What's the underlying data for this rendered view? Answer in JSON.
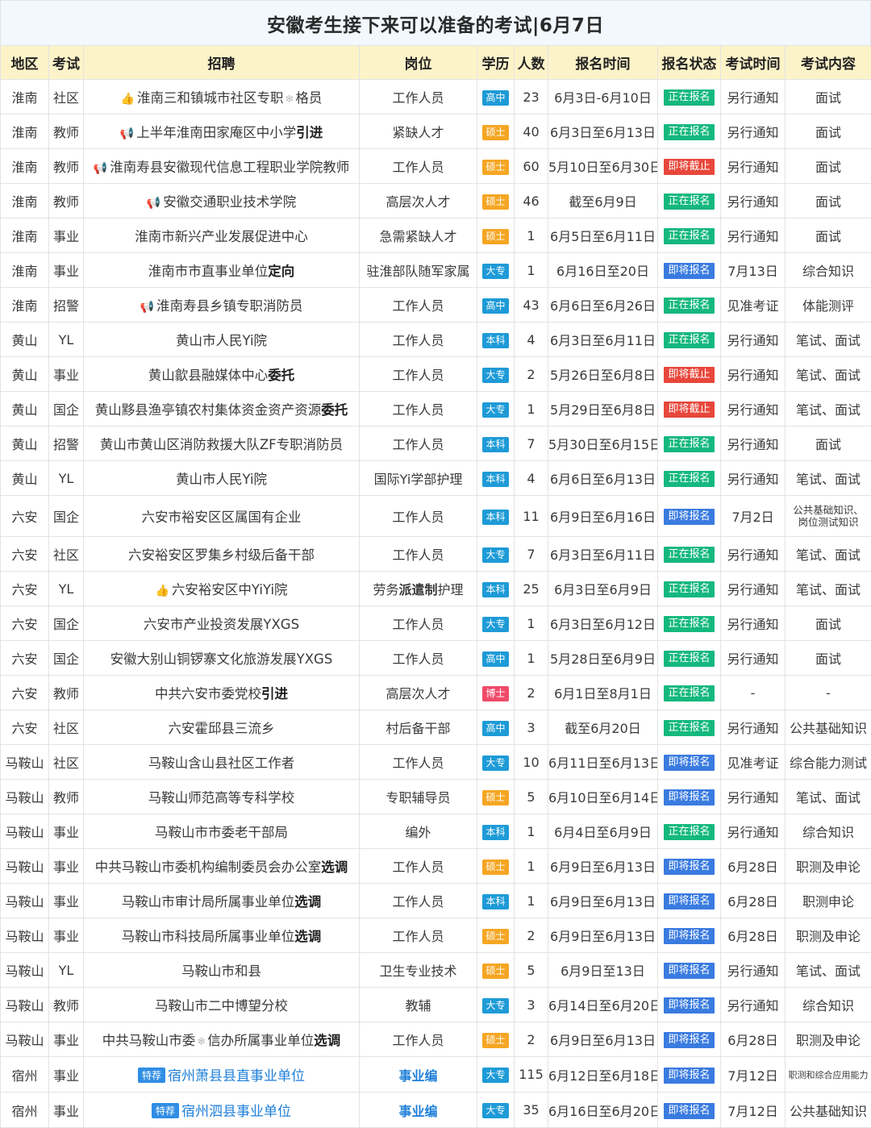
{
  "title": "安徽考生接下来可以准备的考试|6月7日",
  "headers": [
    "地区",
    "考试",
    "招聘",
    "岗位",
    "学历",
    "人数",
    "报名时间",
    "报名状态",
    "考试时间",
    "考试内容"
  ],
  "rows": [
    {
      "region": "淮南",
      "type": "社区",
      "icon": "thumb",
      "recruit": [
        "淮南三和镇城市社区专职",
        "*",
        "格员"
      ],
      "post": "工作人员",
      "edu": "高中",
      "num": "23",
      "reg": "6月3日-6月10日",
      "status": "正在报名",
      "exam": "另行通知",
      "content": "面试"
    },
    {
      "region": "淮南",
      "type": "教师",
      "icon": "megaphone",
      "recruit": [
        "上半年淮南田家庵区中小学"
      ],
      "recruit_bold": "引进",
      "post": "紧缺人才",
      "edu": "硕士",
      "num": "40",
      "reg": "6月3日至6月13日",
      "status": "正在报名",
      "exam": "另行通知",
      "content": "面试"
    },
    {
      "region": "淮南",
      "type": "教师",
      "icon": "megaphone",
      "recruit": [
        "淮南寿县安徽现代信息工程职业学院教师"
      ],
      "post": "工作人员",
      "edu": "硕士",
      "num": "60",
      "reg": "5月10日至6月30日",
      "status": "即将截止",
      "exam": "另行通知",
      "content": "面试"
    },
    {
      "region": "淮南",
      "type": "教师",
      "icon": "megaphone",
      "recruit": [
        "安徽交通职业技术学院"
      ],
      "post": "高层次人才",
      "edu": "硕士",
      "num": "46",
      "reg": "截至6月9日",
      "status": "正在报名",
      "exam": "另行通知",
      "content": "面试"
    },
    {
      "region": "淮南",
      "type": "事业",
      "recruit": [
        "淮南市新兴产业发展促进中心"
      ],
      "post": "急需紧缺人才",
      "edu": "硕士",
      "num": "1",
      "reg": "6月5日至6月11日",
      "status": "正在报名",
      "exam": "另行通知",
      "content": "面试"
    },
    {
      "region": "淮南",
      "type": "事业",
      "recruit": [
        "淮南市市直事业单位"
      ],
      "recruit_bold": "定向",
      "post": "驻淮部队随军家属",
      "edu": "大专",
      "num": "1",
      "reg": "6月16日至20日",
      "status": "即将报名",
      "exam": "7月13日",
      "content": "综合知识"
    },
    {
      "region": "淮南",
      "type": "招警",
      "icon": "megaphone",
      "recruit": [
        "淮南寿县乡镇专职消防员"
      ],
      "post": "工作人员",
      "edu": "高中",
      "num": "43",
      "reg": "6月6日至6月26日",
      "status": "正在报名",
      "exam": "见准考证",
      "content": "体能测评"
    },
    {
      "region": "黄山",
      "type": "YL",
      "recruit": [
        "黄山市人民Yi院"
      ],
      "post": "工作人员",
      "edu": "本科",
      "num": "4",
      "reg": "6月3日至6月11日",
      "status": "正在报名",
      "exam": "另行通知",
      "content": "笔试、面试"
    },
    {
      "region": "黄山",
      "type": "事业",
      "recruit": [
        "黄山歙县融媒体中心"
      ],
      "recruit_bold": "委托",
      "post": "工作人员",
      "edu": "大专",
      "num": "2",
      "reg": "5月26日至6月8日",
      "status": "即将截止",
      "exam": "另行通知",
      "content": "笔试、面试"
    },
    {
      "region": "黄山",
      "type": "国企",
      "recruit": [
        "黄山黟县渔亭镇农村集体资金资产资源"
      ],
      "recruit_bold": "委托",
      "post": "工作人员",
      "edu": "大专",
      "num": "1",
      "reg": "5月29日至6月8日",
      "status": "即将截止",
      "exam": "另行通知",
      "content": "笔试、面试"
    },
    {
      "region": "黄山",
      "type": "招警",
      "recruit": [
        "黄山市黄山区消防救援大队ZF专职消防员"
      ],
      "post": "工作人员",
      "edu": "本科",
      "num": "7",
      "reg": "5月30日至6月15日",
      "status": "正在报名",
      "exam": "另行通知",
      "content": "面试"
    },
    {
      "region": "黄山",
      "type": "YL",
      "recruit": [
        "黄山市人民Yi院"
      ],
      "post": "国际Yi学部护理",
      "edu": "本科",
      "num": "4",
      "reg": "6月6日至6月13日",
      "status": "正在报名",
      "exam": "另行通知",
      "content": "笔试、面试"
    },
    {
      "region": "六安",
      "type": "国企",
      "recruit": [
        "六安市裕安区区属国有企业"
      ],
      "post": "工作人员",
      "edu": "本科",
      "num": "11",
      "reg": "6月9日至6月16日",
      "status": "即将报名",
      "exam": "7月2日",
      "content": "公共基础知识、岗位测试知识",
      "tall": true
    },
    {
      "region": "六安",
      "type": "社区",
      "recruit": [
        "六安裕安区罗集乡村级后备干部"
      ],
      "post": "工作人员",
      "edu": "大专",
      "num": "7",
      "reg": "6月3日至6月11日",
      "status": "正在报名",
      "exam": "另行通知",
      "content": "笔试、面试"
    },
    {
      "region": "六安",
      "type": "YL",
      "icon": "thumb",
      "recruit": [
        "六安裕安区中YiYi院"
      ],
      "post": "劳务派遣制护理",
      "post_bold": "派遣制",
      "edu": "本科",
      "num": "25",
      "reg": "6月3日至6月9日",
      "status": "正在报名",
      "exam": "另行通知",
      "content": "笔试、面试"
    },
    {
      "region": "六安",
      "type": "国企",
      "recruit": [
        "六安市产业投资发展YXGS"
      ],
      "post": "工作人员",
      "edu": "大专",
      "num": "1",
      "reg": "6月3日至6月12日",
      "status": "正在报名",
      "exam": "另行通知",
      "content": "面试"
    },
    {
      "region": "六安",
      "type": "国企",
      "recruit": [
        "安徽大别山铜锣寨文化旅游发展YXGS"
      ],
      "post": "工作人员",
      "edu": "高中",
      "num": "1",
      "reg": "5月28日至6月9日",
      "status": "正在报名",
      "exam": "另行通知",
      "content": "面试"
    },
    {
      "region": "六安",
      "type": "教师",
      "recruit": [
        "中共六安市委党校"
      ],
      "recruit_bold": "引进",
      "post": "高层次人才",
      "edu": "博士",
      "num": "2",
      "reg": "6月1日至8月1日",
      "status": "正在报名",
      "exam": "-",
      "content": "-"
    },
    {
      "region": "六安",
      "type": "社区",
      "recruit": [
        "六安霍邱县三流乡"
      ],
      "post": "村后备干部",
      "edu": "高中",
      "num": "3",
      "reg": "截至6月20日",
      "status": "正在报名",
      "exam": "另行通知",
      "content": "公共基础知识"
    },
    {
      "region": "马鞍山",
      "type": "社区",
      "recruit": [
        "马鞍山含山县社区工作者"
      ],
      "post": "工作人员",
      "edu": "大专",
      "num": "10",
      "reg": "6月11日至6月13日",
      "status": "即将报名",
      "exam": "见准考证",
      "content": "综合能力测试"
    },
    {
      "region": "马鞍山",
      "type": "教师",
      "recruit": [
        "马鞍山师范高等专科学校"
      ],
      "post": "专职辅导员",
      "edu": "硕士",
      "num": "5",
      "reg": "6月10日至6月14日",
      "status": "即将报名",
      "exam": "另行通知",
      "content": "笔试、面试"
    },
    {
      "region": "马鞍山",
      "type": "事业",
      "recruit": [
        "马鞍山市市委老干部局"
      ],
      "post": "编外",
      "edu": "本科",
      "num": "1",
      "reg": "6月4日至6月9日",
      "status": "正在报名",
      "exam": "另行通知",
      "content": "综合知识"
    },
    {
      "region": "马鞍山",
      "type": "事业",
      "recruit": [
        "中共马鞍山市委机构编制委员会办公室"
      ],
      "recruit_bold": "选调",
      "post": "工作人员",
      "edu": "硕士",
      "num": "1",
      "reg": "6月9日至6月13日",
      "status": "即将报名",
      "exam": "6月28日",
      "content": "职测及申论"
    },
    {
      "region": "马鞍山",
      "type": "事业",
      "recruit": [
        "马鞍山市审计局所属事业单位"
      ],
      "recruit_bold": "选调",
      "post": "工作人员",
      "edu": "本科",
      "num": "1",
      "reg": "6月9日至6月13日",
      "status": "即将报名",
      "exam": "6月28日",
      "content": "职测申论"
    },
    {
      "region": "马鞍山",
      "type": "事业",
      "recruit": [
        "马鞍山市科技局所属事业单位"
      ],
      "recruit_bold": "选调",
      "post": "工作人员",
      "edu": "硕士",
      "num": "2",
      "reg": "6月9日至6月13日",
      "status": "即将报名",
      "exam": "6月28日",
      "content": "职测及申论"
    },
    {
      "region": "马鞍山",
      "type": "YL",
      "recruit": [
        "马鞍山市和县"
      ],
      "post": "卫生专业技术",
      "edu": "硕士",
      "num": "5",
      "reg": "6月9日至13日",
      "status": "即将报名",
      "exam": "另行通知",
      "content": "笔试、面试"
    },
    {
      "region": "马鞍山",
      "type": "教师",
      "recruit": [
        "马鞍山市二中博望分校"
      ],
      "post": "教辅",
      "edu": "大专",
      "num": "3",
      "reg": "6月14日至6月20日",
      "status": "即将报名",
      "exam": "另行通知",
      "content": "综合知识"
    },
    {
      "region": "马鞍山",
      "type": "事业",
      "recruit": [
        "中共马鞍山市委",
        "*",
        "信办所属事业单位"
      ],
      "recruit_bold": "选调",
      "post": "工作人员",
      "edu": "硕士",
      "num": "2",
      "reg": "6月9日至6月13日",
      "status": "即将报名",
      "exam": "6月28日",
      "content": "职测及申论"
    },
    {
      "region": "宿州",
      "type": "事业",
      "tag": "特荐",
      "recruit_link": "宿州萧县县直事业单位",
      "post": "事业编",
      "post_link": true,
      "edu": "大专",
      "num": "115",
      "reg": "6月12日至6月18日",
      "status": "即将报名",
      "exam": "7月12日",
      "content": "职测和综合应用能力",
      "content_small": true
    },
    {
      "region": "宿州",
      "type": "事业",
      "tag": "特荐",
      "recruit_link": "宿州泗县事业单位",
      "post": "事业编",
      "post_link": true,
      "edu": "大专",
      "num": "35",
      "reg": "6月16日至6月20日",
      "status": "即将报名",
      "exam": "7月12日",
      "content": "公共基础知识"
    }
  ]
}
